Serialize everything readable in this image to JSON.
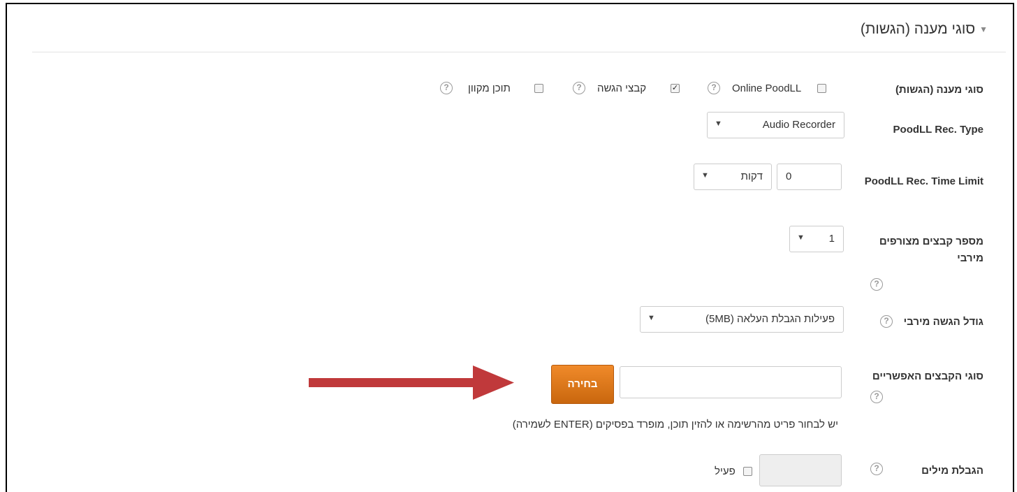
{
  "section": {
    "title": "סוגי מענה (הגשות)"
  },
  "submission_types": {
    "label": "סוגי מענה (הגשות)",
    "options": [
      {
        "label": "Online PoodLL",
        "checked": false
      },
      {
        "label": "קבצי הגשה",
        "checked": true
      },
      {
        "label": "תוכן מקוון",
        "checked": false
      }
    ]
  },
  "rec_type": {
    "label": "PoodLL Rec. Type",
    "value": "Audio Recorder"
  },
  "rec_time_limit": {
    "label": "PoodLL Rec. Time Limit",
    "number": "0",
    "unit": "דקות"
  },
  "max_files": {
    "label": "מספר קבצים מצורפים מירבי",
    "value": "1"
  },
  "max_size": {
    "label": "גודל הגשה מירבי",
    "value": "פעילות הגבלת העלאה (5MB)"
  },
  "file_types": {
    "label": "סוגי הקבצים האפשריים",
    "value": "",
    "button": "בחירה",
    "note": "יש לבחור פריט מהרשימה או להזין תוכן, מופרד בפסיקים (ENTER לשמירה)"
  },
  "word_limit": {
    "label": "הגבלת מילים",
    "value": "",
    "enable_label": "פעיל",
    "enabled": false
  },
  "icons": {
    "help": "help-icon",
    "caret": "caret-down-icon",
    "arrow": "annotation-arrow"
  },
  "colors": {
    "button": "#e27a1c",
    "arrow": "#c0393b"
  }
}
